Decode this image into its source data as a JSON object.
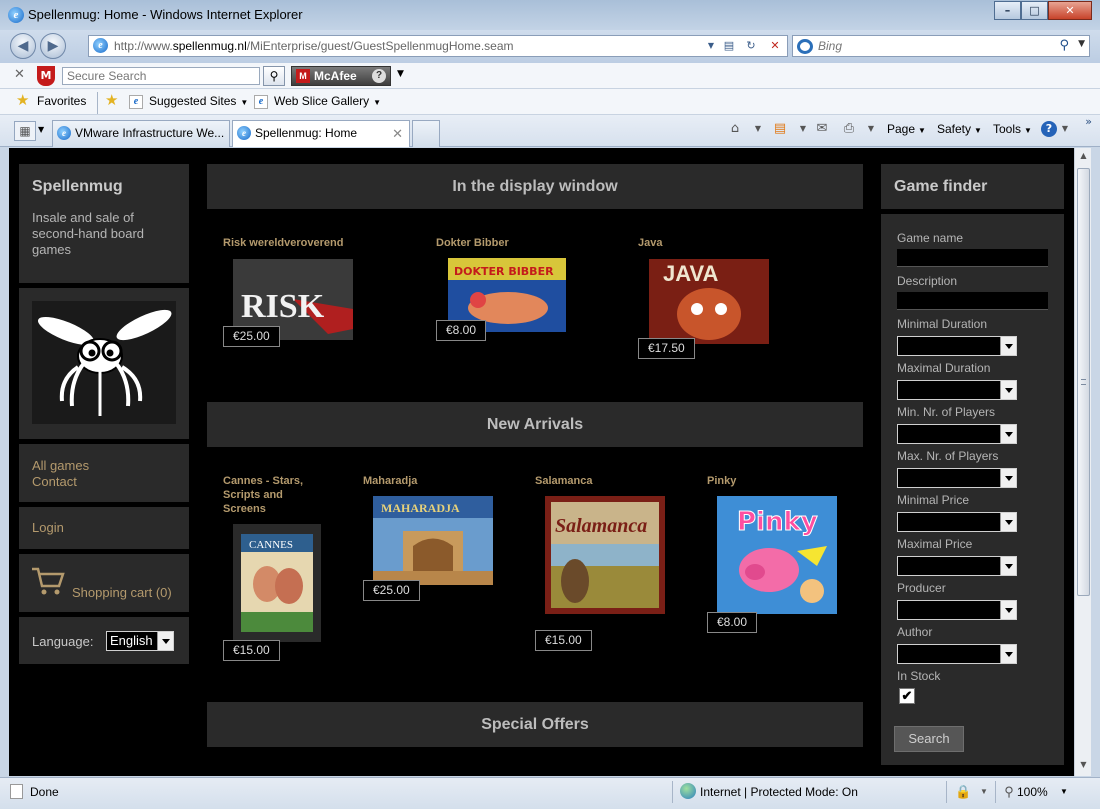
{
  "window": {
    "title": "Spellenmug: Home - Windows Internet Explorer",
    "minimize": "–",
    "maximize": "□",
    "close": "✕"
  },
  "address": {
    "url_prefix": "http://www.",
    "url_host": "spellenmug.nl",
    "url_path": "/MiEnterprise/guest/GuestSpellenmugHome.seam",
    "search_placeholder": "Bing"
  },
  "mcafee": {
    "search_placeholder": "Secure Search",
    "button_label": "McAfee",
    "help": "?"
  },
  "favorites": {
    "favorites_label": "Favorites",
    "suggested_label": "Suggested Sites",
    "webslice_label": "Web Slice Gallery"
  },
  "tabs": [
    {
      "label": "VMware Infrastructure We..."
    },
    {
      "label": "Spellenmug: Home"
    }
  ],
  "commands": {
    "page": "Page",
    "safety": "Safety",
    "tools": "Tools"
  },
  "site": {
    "name": "Spellenmug",
    "tagline": "Insale and sale of second-hand board games",
    "menu": [
      "All games",
      "Contact"
    ],
    "login": "Login",
    "cart": "Shopping cart (0)",
    "language_label": "Language:",
    "language_value": "English"
  },
  "sections": {
    "display_window": "In the display window",
    "new_arrivals": "New Arrivals",
    "special_offers": "Special Offers"
  },
  "display_games": [
    {
      "title": "Risk wereldveroverend",
      "price": "€25.00",
      "art": "RISK"
    },
    {
      "title": "Dokter Bibber",
      "price": "€8.00",
      "art": "DOKTER BIBBER"
    },
    {
      "title": "Java",
      "price": "€17.50",
      "art": "JAVA"
    }
  ],
  "new_games": [
    {
      "title": "Cannes - Stars, Scripts and Screens",
      "price": "€15.00",
      "art": "CANNES"
    },
    {
      "title": "Maharadja",
      "price": "€25.00",
      "art": "MAHARADJA"
    },
    {
      "title": "Salamanca",
      "price": "€15.00",
      "art": "Salamanca"
    },
    {
      "title": "Pinky",
      "price": "€8.00",
      "art": "Pinky"
    }
  ],
  "finder": {
    "title": "Game finder",
    "game_name": "Game name",
    "description": "Description",
    "min_duration": "Minimal Duration",
    "max_duration": "Maximal Duration",
    "min_players": "Min. Nr. of Players",
    "max_players": "Max. Nr. of Players",
    "min_price": "Minimal Price",
    "max_price": "Maximal Price",
    "producer": "Producer",
    "author": "Author",
    "in_stock": "In Stock",
    "in_stock_checked": true,
    "search_button": "Search"
  },
  "status": {
    "text": "Done",
    "zone": "Internet | Protected Mode: On",
    "zoom": "100%"
  },
  "colors": {
    "page_bg": "#000000",
    "panel_bg": "#2a2a2a",
    "link": "#b49a6d"
  }
}
